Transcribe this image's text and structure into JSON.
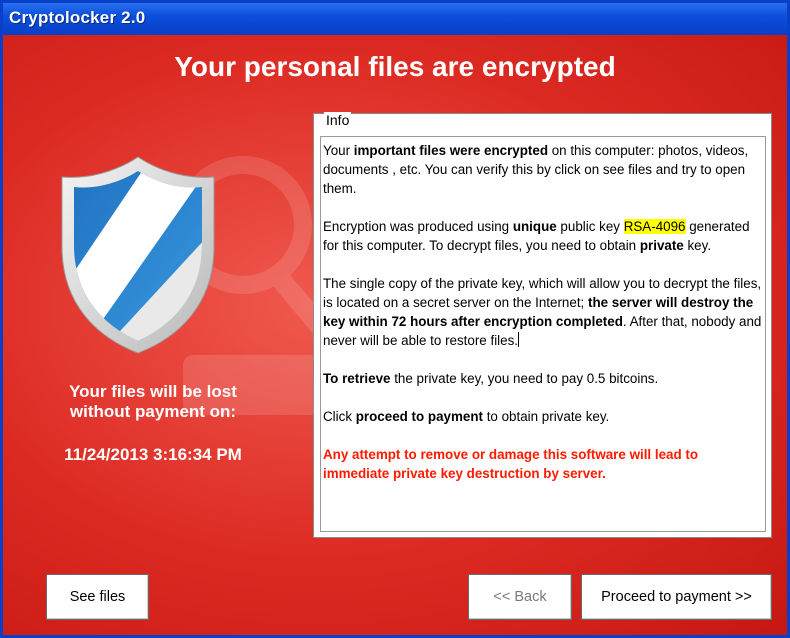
{
  "window": {
    "title": "Cryptolocker 2.0"
  },
  "header": {
    "headline": "Your personal files are encrypted"
  },
  "left_panel": {
    "lost_line1": "Your files will be lost",
    "lost_line2": "without payment on:",
    "deadline": "11/24/2013 3:16:34 PM",
    "shield_icon": "shield-icon"
  },
  "info": {
    "legend": "Info",
    "p1": {
      "a": "Your ",
      "b": "important files were encrypted",
      "c": " on this computer: photos, videos, documents , etc. You can verify this by click on see files and try to open them."
    },
    "p2": {
      "a": "Encryption was produced using ",
      "b": "unique",
      "c": " public key ",
      "key": "RSA-4096",
      "d": " generated for this computer. To decrypt files, you need to obtain ",
      "e": "private",
      "f": " key."
    },
    "p3": {
      "a": "The single copy of the private key, which will allow you to decrypt the files, is located on a secret server on the Internet; ",
      "b": "the server will destroy the key within 72 hours after encryption completed",
      "c": ". After that, nobody and never will be able to restore files."
    },
    "p4": {
      "a": "To retrieve",
      "b": " the private key, you need to pay 0.5 bitcoins."
    },
    "p5": {
      "a": "Click ",
      "b": "proceed to payment",
      "c": " to obtain private key."
    },
    "warning": "Any attempt to remove or damage this software will lead to immediate private key destruction by server."
  },
  "buttons": {
    "see_files": "See files",
    "back": "<< Back",
    "proceed": "Proceed to payment >>"
  },
  "colors": {
    "background_red": "#dc2a22",
    "titlebar_blue": "#0a3fc7",
    "warning_red": "#ff1a00",
    "highlight_yellow": "#ffff00",
    "shield_blue": "#2a7fc8"
  }
}
